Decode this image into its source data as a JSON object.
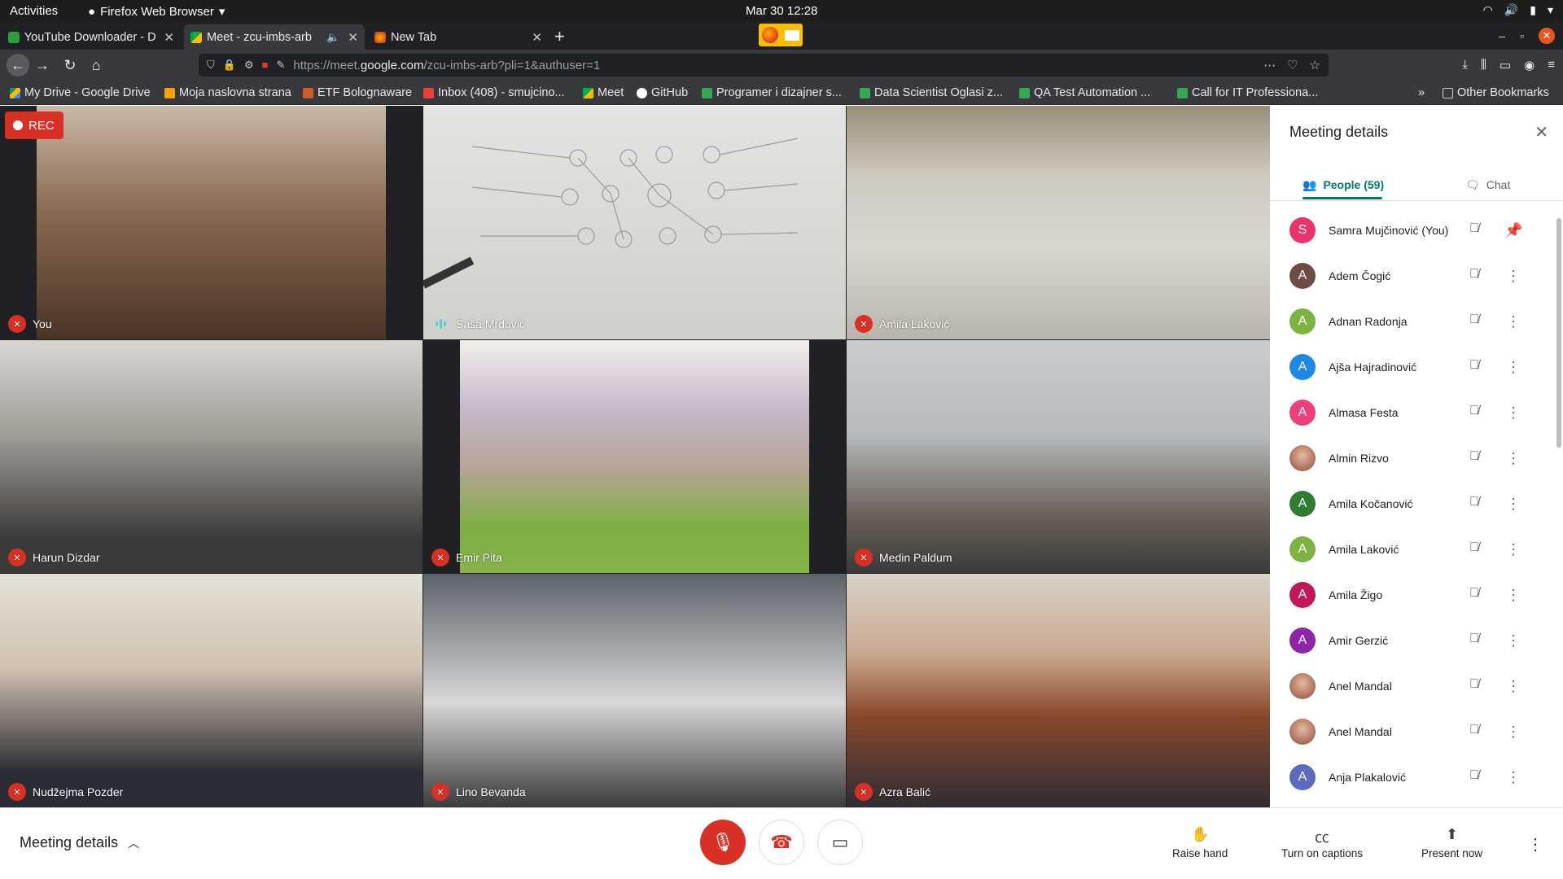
{
  "system": {
    "activities": "Activities",
    "app_name": "Firefox Web Browser",
    "clock": "Mar 30  12:28"
  },
  "tabs": [
    {
      "title": "YouTube Downloader - D",
      "favicon_color": "#2e9d3a"
    },
    {
      "title": "Meet - zcu-imbs-arb",
      "favicon_color": "#00ac47",
      "active": true
    },
    {
      "title": "New Tab",
      "favicon_color": "#e66000"
    }
  ],
  "navbar": {
    "url_prefix": "https://meet.",
    "url_host": "google.com",
    "url_path": "/zcu-imbs-arb?pli=1&authuser=1"
  },
  "bookmarks": [
    {
      "label": "My Drive - Google Drive",
      "color": "#fbbc04"
    },
    {
      "label": "Moja naslovna strana",
      "color": "#f4a300"
    },
    {
      "label": "ETF Bolognaware",
      "color": "#d05a2a"
    },
    {
      "label": "Inbox (408) - smujcino...",
      "color": "#ea4335"
    },
    {
      "label": "Meet",
      "color": "#00ac47"
    },
    {
      "label": "GitHub",
      "color": "#ffffff"
    },
    {
      "label": "Programer i dizajner s...",
      "color": "#34a853"
    },
    {
      "label": "Data Scientist Oglasi z...",
      "color": "#34a853"
    },
    {
      "label": "QA Test Automation ...",
      "color": "#34a853"
    },
    {
      "label": "Call for IT Professiona...",
      "color": "#34a853"
    },
    {
      "label": "Other Bookmarks",
      "color": "#cccccc"
    }
  ],
  "rec_label": "REC",
  "participants_tiles": [
    {
      "name": "You",
      "status": "muted"
    },
    {
      "name": "Saša Mrdović",
      "status": "speaking"
    },
    {
      "name": "Amila Laković",
      "status": "muted"
    },
    {
      "name": "Harun Dizdar",
      "status": "muted"
    },
    {
      "name": "Emir Pita",
      "status": "muted"
    },
    {
      "name": "Medin Paldum",
      "status": "muted"
    },
    {
      "name": "Nudžejma Pozder",
      "status": "muted"
    },
    {
      "name": "Lino Bevanda",
      "status": "muted"
    },
    {
      "name": "Azra Balić",
      "status": "muted"
    }
  ],
  "panel": {
    "title": "Meeting details",
    "tab_people": "People (59)",
    "tab_chat": "Chat",
    "people": [
      {
        "initial": "S",
        "name": "Samra Mujčinović (You)",
        "color": "#e8336d",
        "self": true
      },
      {
        "initial": "A",
        "name": "Adem Čogić",
        "color": "#6d4c41"
      },
      {
        "initial": "A",
        "name": "Adnan Radonja",
        "color": "#7cb342"
      },
      {
        "initial": "A",
        "name": "Ajša Hajradinović",
        "color": "#1e88e5"
      },
      {
        "initial": "A",
        "name": "Almasa Festa",
        "color": "#ec407a"
      },
      {
        "initial": "",
        "name": "Almin Rizvo",
        "color": "#616161",
        "photo": true
      },
      {
        "initial": "A",
        "name": "Amila Kočanović",
        "color": "#2e7d32"
      },
      {
        "initial": "A",
        "name": "Amila Laković",
        "color": "#7cb342"
      },
      {
        "initial": "A",
        "name": "Amila Žigo",
        "color": "#c2185b"
      },
      {
        "initial": "A",
        "name": "Amir Gerzić",
        "color": "#8e24aa"
      },
      {
        "initial": "",
        "name": "Anel Mandal",
        "color": "#b07a66",
        "photo": true
      },
      {
        "initial": "",
        "name": "Anel Mandal",
        "color": "#b07a66",
        "photo": true
      },
      {
        "initial": "A",
        "name": "Anja Plakalović",
        "color": "#5c6bc0"
      }
    ]
  },
  "bottombar": {
    "meeting_details": "Meeting details",
    "raise_hand": "Raise hand",
    "captions": "Turn on captions",
    "present": "Present now"
  }
}
